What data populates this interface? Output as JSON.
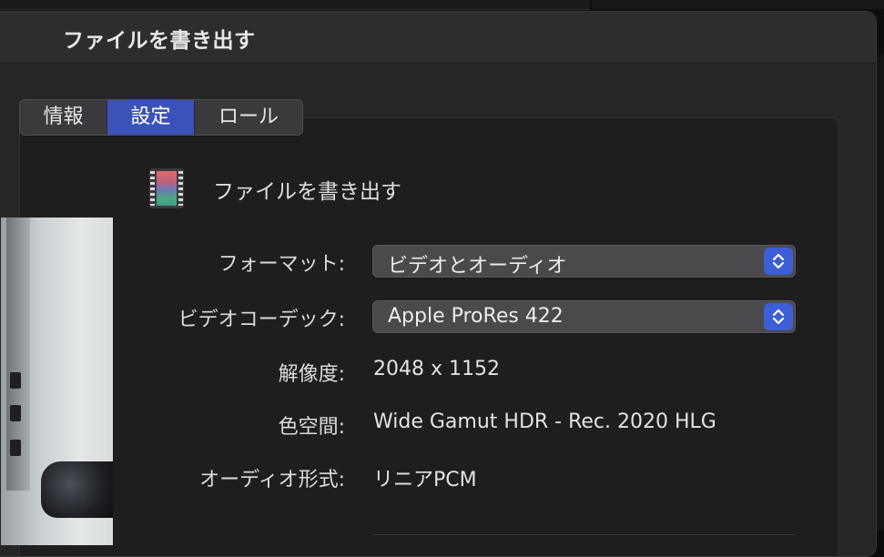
{
  "window": {
    "title": "ファイルを書き出す"
  },
  "tabs": [
    {
      "label": "情報",
      "selected": false
    },
    {
      "label": "設定",
      "selected": true
    },
    {
      "label": "ロール",
      "selected": false
    }
  ],
  "export": {
    "heading": "ファイルを書き出す",
    "icon": "film-strip-icon"
  },
  "settings": {
    "format": {
      "label": "フォーマット:",
      "value": "ビデオとオーディオ"
    },
    "video_codec": {
      "label": "ビデオコーデック:",
      "value": "Apple ProRes 422"
    },
    "resolution": {
      "label": "解像度:",
      "value": "2048 x 1152"
    },
    "color_space": {
      "label": "色空間:",
      "value": "Wide Gamut HDR - Rec. 2020 HLG"
    },
    "audio_format": {
      "label": "オーディオ形式:",
      "value": "リニアPCM"
    }
  },
  "colors": {
    "selected_tab": "#3b53b8",
    "stepper": "#3c5fd6",
    "window_bg": "#262628"
  }
}
